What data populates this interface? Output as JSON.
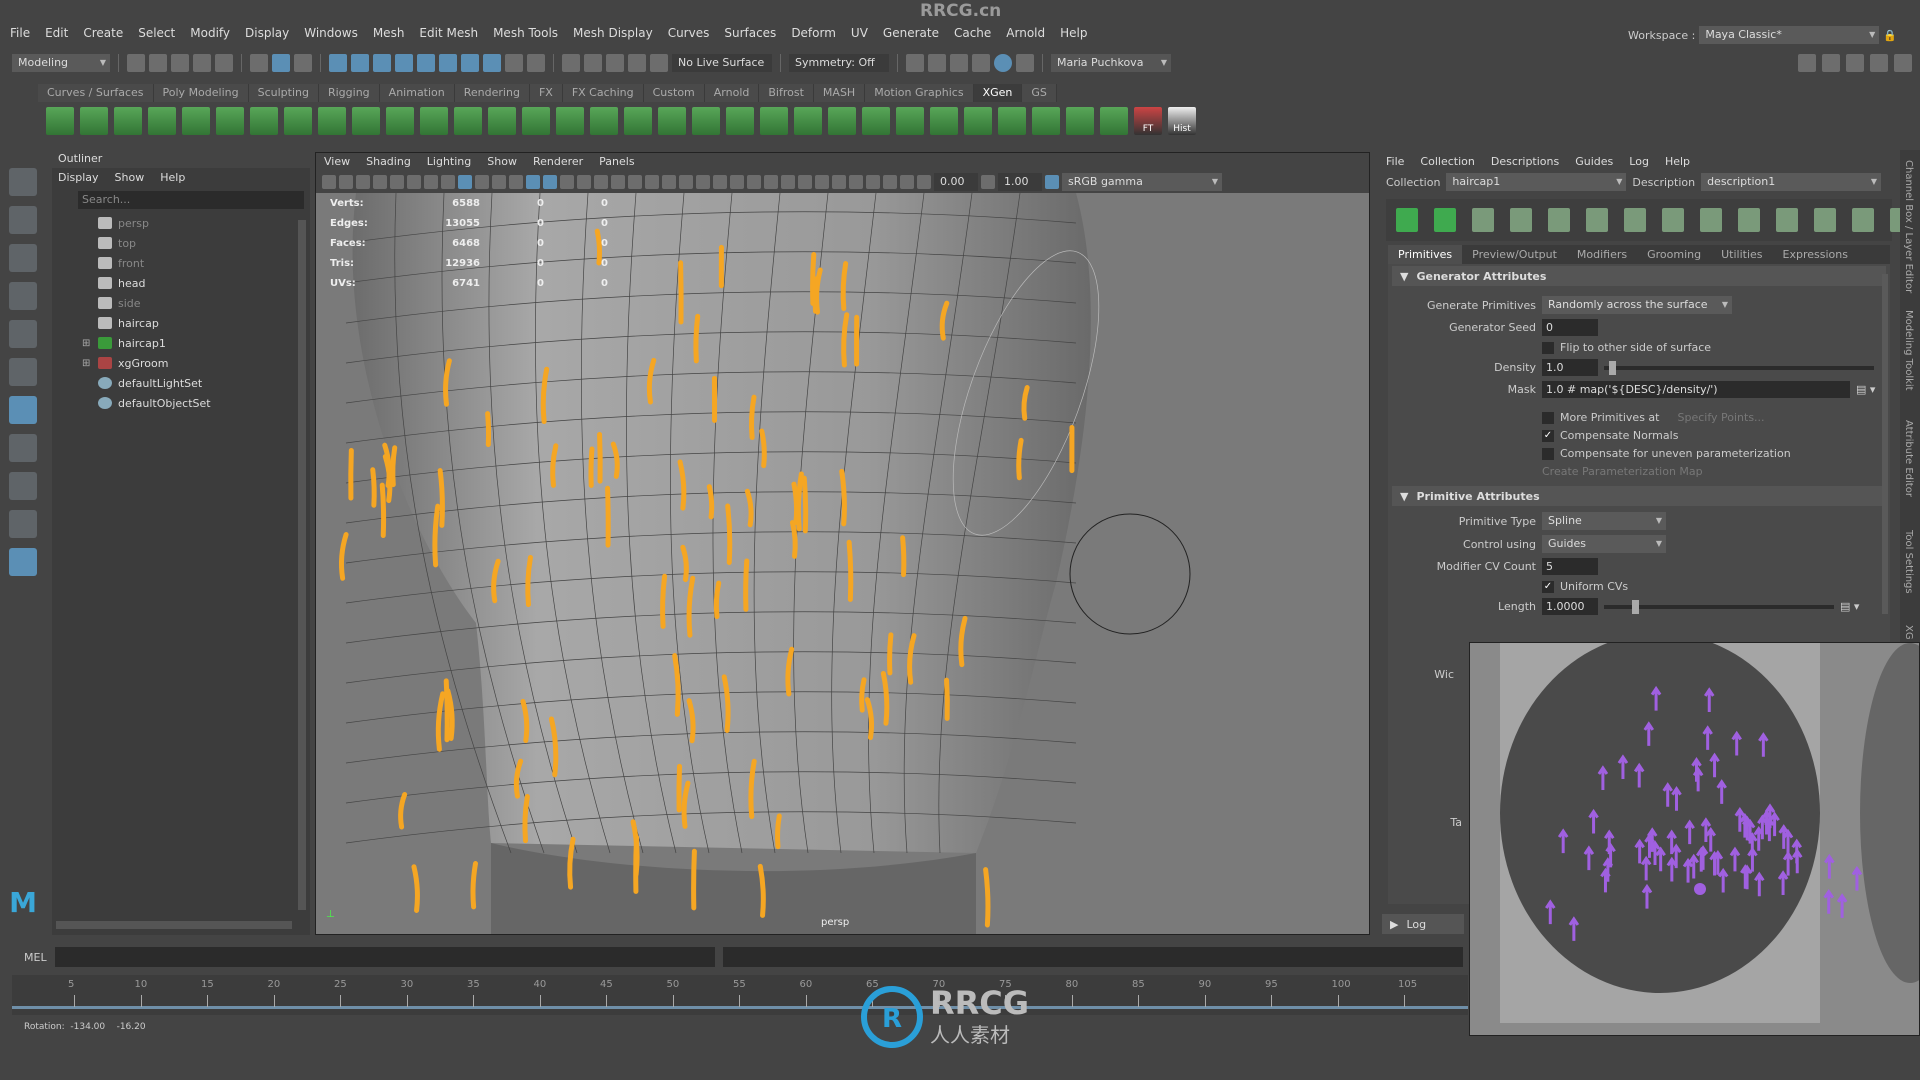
{
  "watermark": "RRCG.cn",
  "menu": [
    "File",
    "Edit",
    "Create",
    "Select",
    "Modify",
    "Display",
    "Windows",
    "Mesh",
    "Edit Mesh",
    "Mesh Tools",
    "Mesh Display",
    "Curves",
    "Surfaces",
    "Deform",
    "UV",
    "Generate",
    "Cache",
    "Arnold",
    "Help"
  ],
  "workspace": {
    "label": "Workspace :",
    "value": "Maya Classic*"
  },
  "status": {
    "mode": "Modeling",
    "live_surface": "No Live Surface",
    "symmetry": "Symmetry: Off",
    "user": "Maria Puchkova"
  },
  "shelf": {
    "tabs": [
      "Curves / Surfaces",
      "Poly Modeling",
      "Sculpting",
      "Rigging",
      "Animation",
      "Rendering",
      "FX",
      "FX Caching",
      "Custom",
      "Arnold",
      "Bifrost",
      "MASH",
      "Motion Graphics",
      "XGen",
      "GS"
    ],
    "active": "XGen",
    "labels": {
      "ft": "FT",
      "hist": "Hist"
    }
  },
  "outliner": {
    "title": "Outliner",
    "menu": [
      "Display",
      "Show",
      "Help"
    ],
    "search_placeholder": "Search...",
    "items": [
      {
        "name": "persp",
        "icon": "camera-icon",
        "dim": true
      },
      {
        "name": "top",
        "icon": "camera-icon",
        "dim": true
      },
      {
        "name": "front",
        "icon": "camera-icon",
        "dim": true
      },
      {
        "name": "head",
        "icon": "mesh-icon",
        "dim": false
      },
      {
        "name": "side",
        "icon": "camera-icon",
        "dim": true
      },
      {
        "name": "haircap",
        "icon": "mesh-icon",
        "dim": false
      },
      {
        "name": "haircap1",
        "icon": "xgen-collection-icon",
        "dim": false,
        "expand": true
      },
      {
        "name": "xgGroom",
        "icon": "groom-icon",
        "dim": false,
        "expand": true
      },
      {
        "name": "defaultLightSet",
        "icon": "set-icon",
        "dim": false
      },
      {
        "name": "defaultObjectSet",
        "icon": "set-icon",
        "dim": false
      }
    ]
  },
  "viewport": {
    "menu": [
      "View",
      "Shading",
      "Lighting",
      "Show",
      "Renderer",
      "Panels"
    ],
    "exposure": "0.00",
    "gamma": "1.00",
    "color_space": "sRGB gamma",
    "camera": "persp",
    "hud": [
      {
        "label": "Verts:",
        "v": [
          "6588",
          "0",
          "0"
        ]
      },
      {
        "label": "Edges:",
        "v": [
          "13055",
          "0",
          "0"
        ]
      },
      {
        "label": "Faces:",
        "v": [
          "6468",
          "0",
          "0"
        ]
      },
      {
        "label": "Tris:",
        "v": [
          "12936",
          "0",
          "0"
        ]
      },
      {
        "label": "UVs:",
        "v": [
          "6741",
          "0",
          "0"
        ]
      }
    ],
    "colors": {
      "mesh": "#8a8a8a",
      "guides": "#f5a623"
    }
  },
  "xgen": {
    "menu": [
      "File",
      "Collection",
      "Descriptions",
      "Guides",
      "Log",
      "Help"
    ],
    "collection_label": "Collection",
    "collection": "haircap1",
    "description_label": "Description",
    "description": "description1",
    "tabs": [
      "Primitives",
      "Preview/Output",
      "Modifiers",
      "Grooming",
      "Utilities",
      "Expressions"
    ],
    "active_tab": "Primitives",
    "gen": {
      "title": "Generator Attributes",
      "generate_label": "Generate Primitives",
      "generate": "Randomly across the surface",
      "seed_label": "Generator Seed",
      "seed": "0",
      "flip": "Flip to other side of surface",
      "flip_checked": false,
      "density_label": "Density",
      "density": "1.0",
      "mask_label": "Mask",
      "mask": "1.0 # map('${DESC}/density/')",
      "more": "More Primitives at",
      "more_checked": false,
      "specify": "Specify Points...",
      "comp_normals": "Compensate Normals",
      "comp_normals_checked": true,
      "comp_uneven": "Compensate for uneven parameterization",
      "comp_uneven_checked": false,
      "create_map": "Create Parameterization Map"
    },
    "prim": {
      "title": "Primitive Attributes",
      "type_label": "Primitive Type",
      "type": "Spline",
      "control_label": "Control using",
      "control": "Guides",
      "cv_label": "Modifier CV Count",
      "cv": "5",
      "uniform": "Uniform CVs",
      "uniform_checked": true,
      "length_label": "Length",
      "length": "1.0000",
      "width_label": "Wic",
      "taper_label": "Ta"
    },
    "log": "Log"
  },
  "side_tabs": [
    "Channel Box / Layer Editor",
    "Modeling Toolkit",
    "Attribute Editor",
    "Tool Settings",
    "XG"
  ],
  "mel": "MEL",
  "timeline": {
    "ticks": [
      "5",
      "10",
      "15",
      "20",
      "25",
      "30",
      "35",
      "40",
      "45",
      "50",
      "55",
      "60",
      "65",
      "70",
      "75",
      "80",
      "85",
      "90",
      "95",
      "100",
      "105"
    ]
  },
  "statusline": "Rotation:  -134.00    -16.20",
  "logo": {
    "title": "RRCG",
    "sub": "人人素材"
  }
}
